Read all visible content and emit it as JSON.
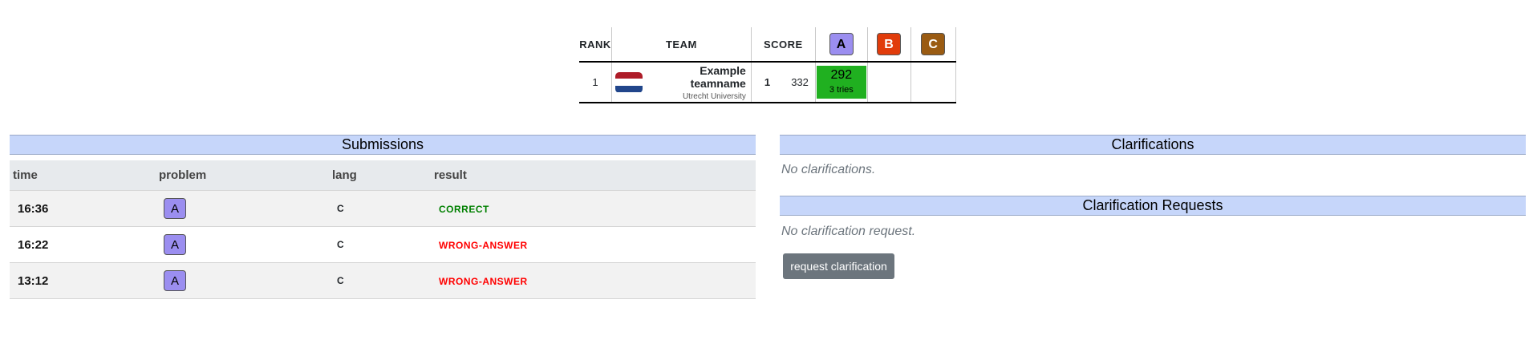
{
  "scoreboard": {
    "headers": {
      "rank": "RANK",
      "team": "TEAM",
      "score": "SCORE"
    },
    "problems": [
      {
        "label": "A",
        "color": "#9b8ef0",
        "text_color": "#000000"
      },
      {
        "label": "B",
        "color": "#e13c0b",
        "text_color": "#ffffff"
      },
      {
        "label": "C",
        "color": "#9a5b12",
        "text_color": "#ffffff"
      }
    ],
    "row": {
      "rank": "1",
      "flag_icon": "netherlands-flag-icon",
      "flag_colors": [
        "#ae1c28",
        "#ffffff",
        "#21468b"
      ],
      "team_name": "Example teamname",
      "affiliation": "Utrecht University",
      "solved": "1",
      "penalty": "332",
      "problem_results": [
        {
          "points": "292",
          "tries": "3 tries",
          "status_color": "#20b020"
        },
        {
          "points": "",
          "tries": ""
        },
        {
          "points": "",
          "tries": ""
        }
      ]
    }
  },
  "submissions": {
    "title": "Submissions",
    "columns": [
      "time",
      "problem",
      "lang",
      "result"
    ],
    "rows": [
      {
        "time": "16:36",
        "problem": "A",
        "lang": "C",
        "result": "CORRECT",
        "result_color": "#008000"
      },
      {
        "time": "16:22",
        "problem": "A",
        "lang": "C",
        "result": "WRONG-ANSWER",
        "result_color": "#ff0000"
      },
      {
        "time": "13:12",
        "problem": "A",
        "lang": "C",
        "result": "WRONG-ANSWER",
        "result_color": "#ff0000"
      }
    ]
  },
  "clarifications": {
    "title": "Clarifications",
    "empty_text": "No clarifications."
  },
  "clarification_requests": {
    "title": "Clarification Requests",
    "empty_text": "No clarification request.",
    "button_label": "request clarification"
  }
}
